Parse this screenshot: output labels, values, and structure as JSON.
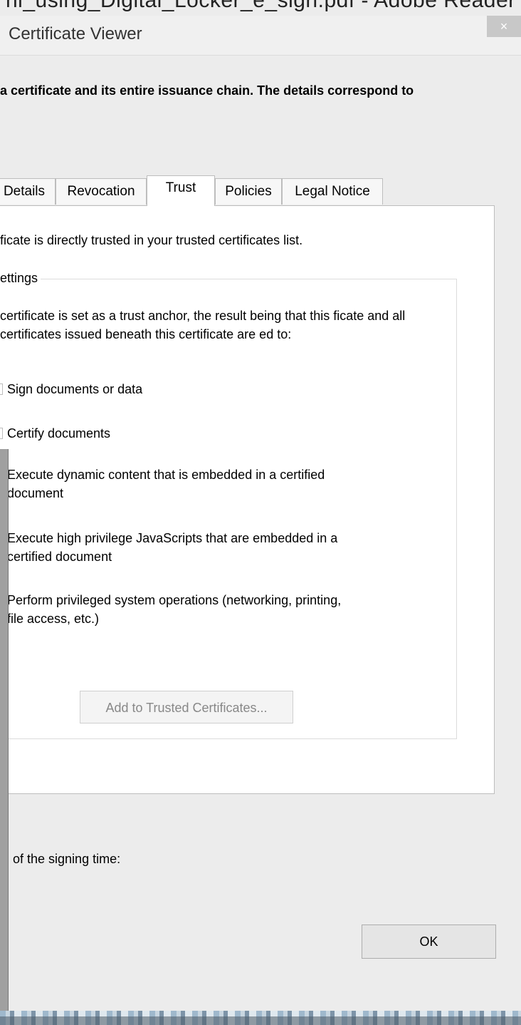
{
  "window": {
    "background_title": "ni_using_Digital_Locker_e_sign.pdf - Adobe Reader",
    "dialog_title": "Certificate Viewer",
    "close_glyph": "×"
  },
  "intro_text": "a certificate and its entire issuance chain. The details correspond to",
  "tabs": [
    {
      "label": "Details",
      "active": false
    },
    {
      "label": "Revocation",
      "active": false
    },
    {
      "label": "Trust",
      "active": true
    },
    {
      "label": "Policies",
      "active": false
    },
    {
      "label": "Legal Notice",
      "active": false
    }
  ],
  "trust": {
    "status": "ficate is directly trusted in your trusted certificates list.",
    "group_label": "ettings",
    "anchor_text": "certificate is set as a trust anchor, the result being that this ficate and all certificates issued beneath this certificate are ed to:",
    "permissions": [
      {
        "line1": "Sign documents or data",
        "line2": ""
      },
      {
        "line1": "Certify documents",
        "line2": ""
      },
      {
        "line1": "Execute dynamic content that is embedded in a certified",
        "line2": "document"
      },
      {
        "line1": "Execute high privilege JavaScripts that are embedded in a",
        "line2": "certified document"
      },
      {
        "line1": "Perform privileged system operations (networking, printing,",
        "line2": "file access, etc.)"
      }
    ],
    "add_button": "Add to Trusted Certificates..."
  },
  "signing_note": "of the signing time:",
  "ok_button": "OK",
  "colors": {
    "panel_bg": "#ffffff",
    "dialog_bg": "#ececec",
    "disabled_text": "#888888",
    "close_button": "#c8c8c8"
  }
}
